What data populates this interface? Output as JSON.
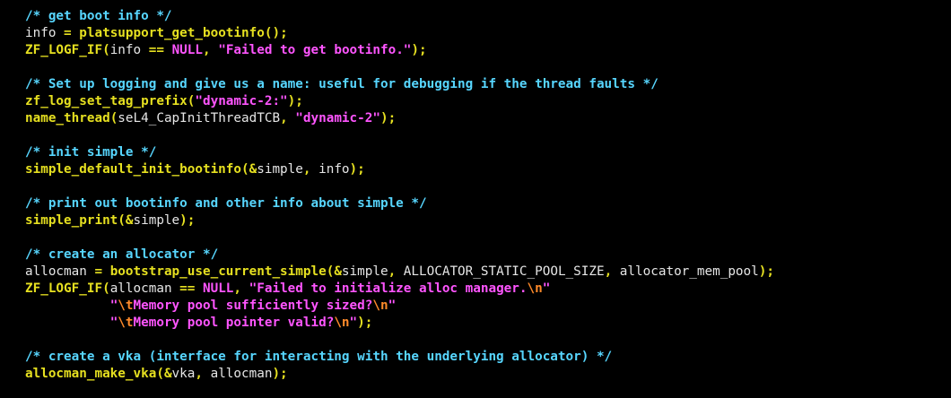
{
  "code": {
    "lines": [
      {
        "tokens": [
          {
            "t": "comment",
            "v": "/* get boot info */"
          }
        ]
      },
      {
        "tokens": [
          {
            "t": "var",
            "v": "info "
          },
          {
            "t": "op",
            "v": "="
          },
          {
            "t": "var",
            "v": " "
          },
          {
            "t": "fn",
            "v": "platsupport_get_bootinfo"
          },
          {
            "t": "punc",
            "v": "();"
          }
        ]
      },
      {
        "tokens": [
          {
            "t": "fn",
            "v": "ZF_LOGF_IF"
          },
          {
            "t": "punc",
            "v": "("
          },
          {
            "t": "var",
            "v": "info "
          },
          {
            "t": "op",
            "v": "=="
          },
          {
            "t": "var",
            "v": " "
          },
          {
            "t": "kw",
            "v": "NULL"
          },
          {
            "t": "punc",
            "v": ","
          },
          {
            "t": "var",
            "v": " "
          },
          {
            "t": "str",
            "v": "\"Failed to get bootinfo.\""
          },
          {
            "t": "punc",
            "v": ");"
          }
        ]
      },
      {
        "tokens": []
      },
      {
        "tokens": [
          {
            "t": "comment",
            "v": "/* Set up logging and give us a name: useful for debugging if the thread faults */"
          }
        ]
      },
      {
        "tokens": [
          {
            "t": "fn",
            "v": "zf_log_set_tag_prefix"
          },
          {
            "t": "punc",
            "v": "("
          },
          {
            "t": "str",
            "v": "\"dynamic-2:\""
          },
          {
            "t": "punc",
            "v": ");"
          }
        ]
      },
      {
        "tokens": [
          {
            "t": "fn",
            "v": "name_thread"
          },
          {
            "t": "punc",
            "v": "("
          },
          {
            "t": "var",
            "v": "seL4_CapInitThreadTCB"
          },
          {
            "t": "punc",
            "v": ","
          },
          {
            "t": "var",
            "v": " "
          },
          {
            "t": "str",
            "v": "\"dynamic-2\""
          },
          {
            "t": "punc",
            "v": ");"
          }
        ]
      },
      {
        "tokens": []
      },
      {
        "tokens": [
          {
            "t": "comment",
            "v": "/* init simple */"
          }
        ]
      },
      {
        "tokens": [
          {
            "t": "fn",
            "v": "simple_default_init_bootinfo"
          },
          {
            "t": "punc",
            "v": "("
          },
          {
            "t": "op",
            "v": "&"
          },
          {
            "t": "var",
            "v": "simple"
          },
          {
            "t": "punc",
            "v": ","
          },
          {
            "t": "var",
            "v": " info"
          },
          {
            "t": "punc",
            "v": ");"
          }
        ]
      },
      {
        "tokens": []
      },
      {
        "tokens": [
          {
            "t": "comment",
            "v": "/* print out bootinfo and other info about simple */"
          }
        ]
      },
      {
        "tokens": [
          {
            "t": "fn",
            "v": "simple_print"
          },
          {
            "t": "punc",
            "v": "("
          },
          {
            "t": "op",
            "v": "&"
          },
          {
            "t": "var",
            "v": "simple"
          },
          {
            "t": "punc",
            "v": ");"
          }
        ]
      },
      {
        "tokens": []
      },
      {
        "tokens": [
          {
            "t": "comment",
            "v": "/* create an allocator */"
          }
        ]
      },
      {
        "tokens": [
          {
            "t": "var",
            "v": "allocman "
          },
          {
            "t": "op",
            "v": "="
          },
          {
            "t": "var",
            "v": " "
          },
          {
            "t": "fn",
            "v": "bootstrap_use_current_simple"
          },
          {
            "t": "punc",
            "v": "("
          },
          {
            "t": "op",
            "v": "&"
          },
          {
            "t": "var",
            "v": "simple"
          },
          {
            "t": "punc",
            "v": ","
          },
          {
            "t": "var",
            "v": " ALLOCATOR_STATIC_POOL_SIZE"
          },
          {
            "t": "punc",
            "v": ","
          },
          {
            "t": "var",
            "v": " allocator_mem_pool"
          },
          {
            "t": "punc",
            "v": ");"
          }
        ]
      },
      {
        "tokens": [
          {
            "t": "fn",
            "v": "ZF_LOGF_IF"
          },
          {
            "t": "punc",
            "v": "("
          },
          {
            "t": "var",
            "v": "allocman "
          },
          {
            "t": "op",
            "v": "=="
          },
          {
            "t": "var",
            "v": " "
          },
          {
            "t": "kw",
            "v": "NULL"
          },
          {
            "t": "punc",
            "v": ","
          },
          {
            "t": "var",
            "v": " "
          },
          {
            "t": "str",
            "v": "\"Failed to initialize alloc manager."
          },
          {
            "t": "esc",
            "v": "\\n"
          },
          {
            "t": "str",
            "v": "\""
          }
        ]
      },
      {
        "tokens": [
          {
            "t": "var",
            "v": "           "
          },
          {
            "t": "str",
            "v": "\""
          },
          {
            "t": "esc",
            "v": "\\t"
          },
          {
            "t": "str",
            "v": "Memory pool sufficiently sized?"
          },
          {
            "t": "esc",
            "v": "\\n"
          },
          {
            "t": "str",
            "v": "\""
          }
        ]
      },
      {
        "tokens": [
          {
            "t": "var",
            "v": "           "
          },
          {
            "t": "str",
            "v": "\""
          },
          {
            "t": "esc",
            "v": "\\t"
          },
          {
            "t": "str",
            "v": "Memory pool pointer valid?"
          },
          {
            "t": "esc",
            "v": "\\n"
          },
          {
            "t": "str",
            "v": "\""
          },
          {
            "t": "punc",
            "v": ");"
          }
        ]
      },
      {
        "tokens": []
      },
      {
        "tokens": [
          {
            "t": "comment",
            "v": "/* create a vka (interface for interacting with the underlying allocator) */"
          }
        ]
      },
      {
        "tokens": [
          {
            "t": "fn",
            "v": "allocman_make_vka"
          },
          {
            "t": "punc",
            "v": "("
          },
          {
            "t": "op",
            "v": "&"
          },
          {
            "t": "var",
            "v": "vka"
          },
          {
            "t": "punc",
            "v": ","
          },
          {
            "t": "var",
            "v": " allocman"
          },
          {
            "t": "punc",
            "v": ");"
          }
        ]
      }
    ]
  }
}
